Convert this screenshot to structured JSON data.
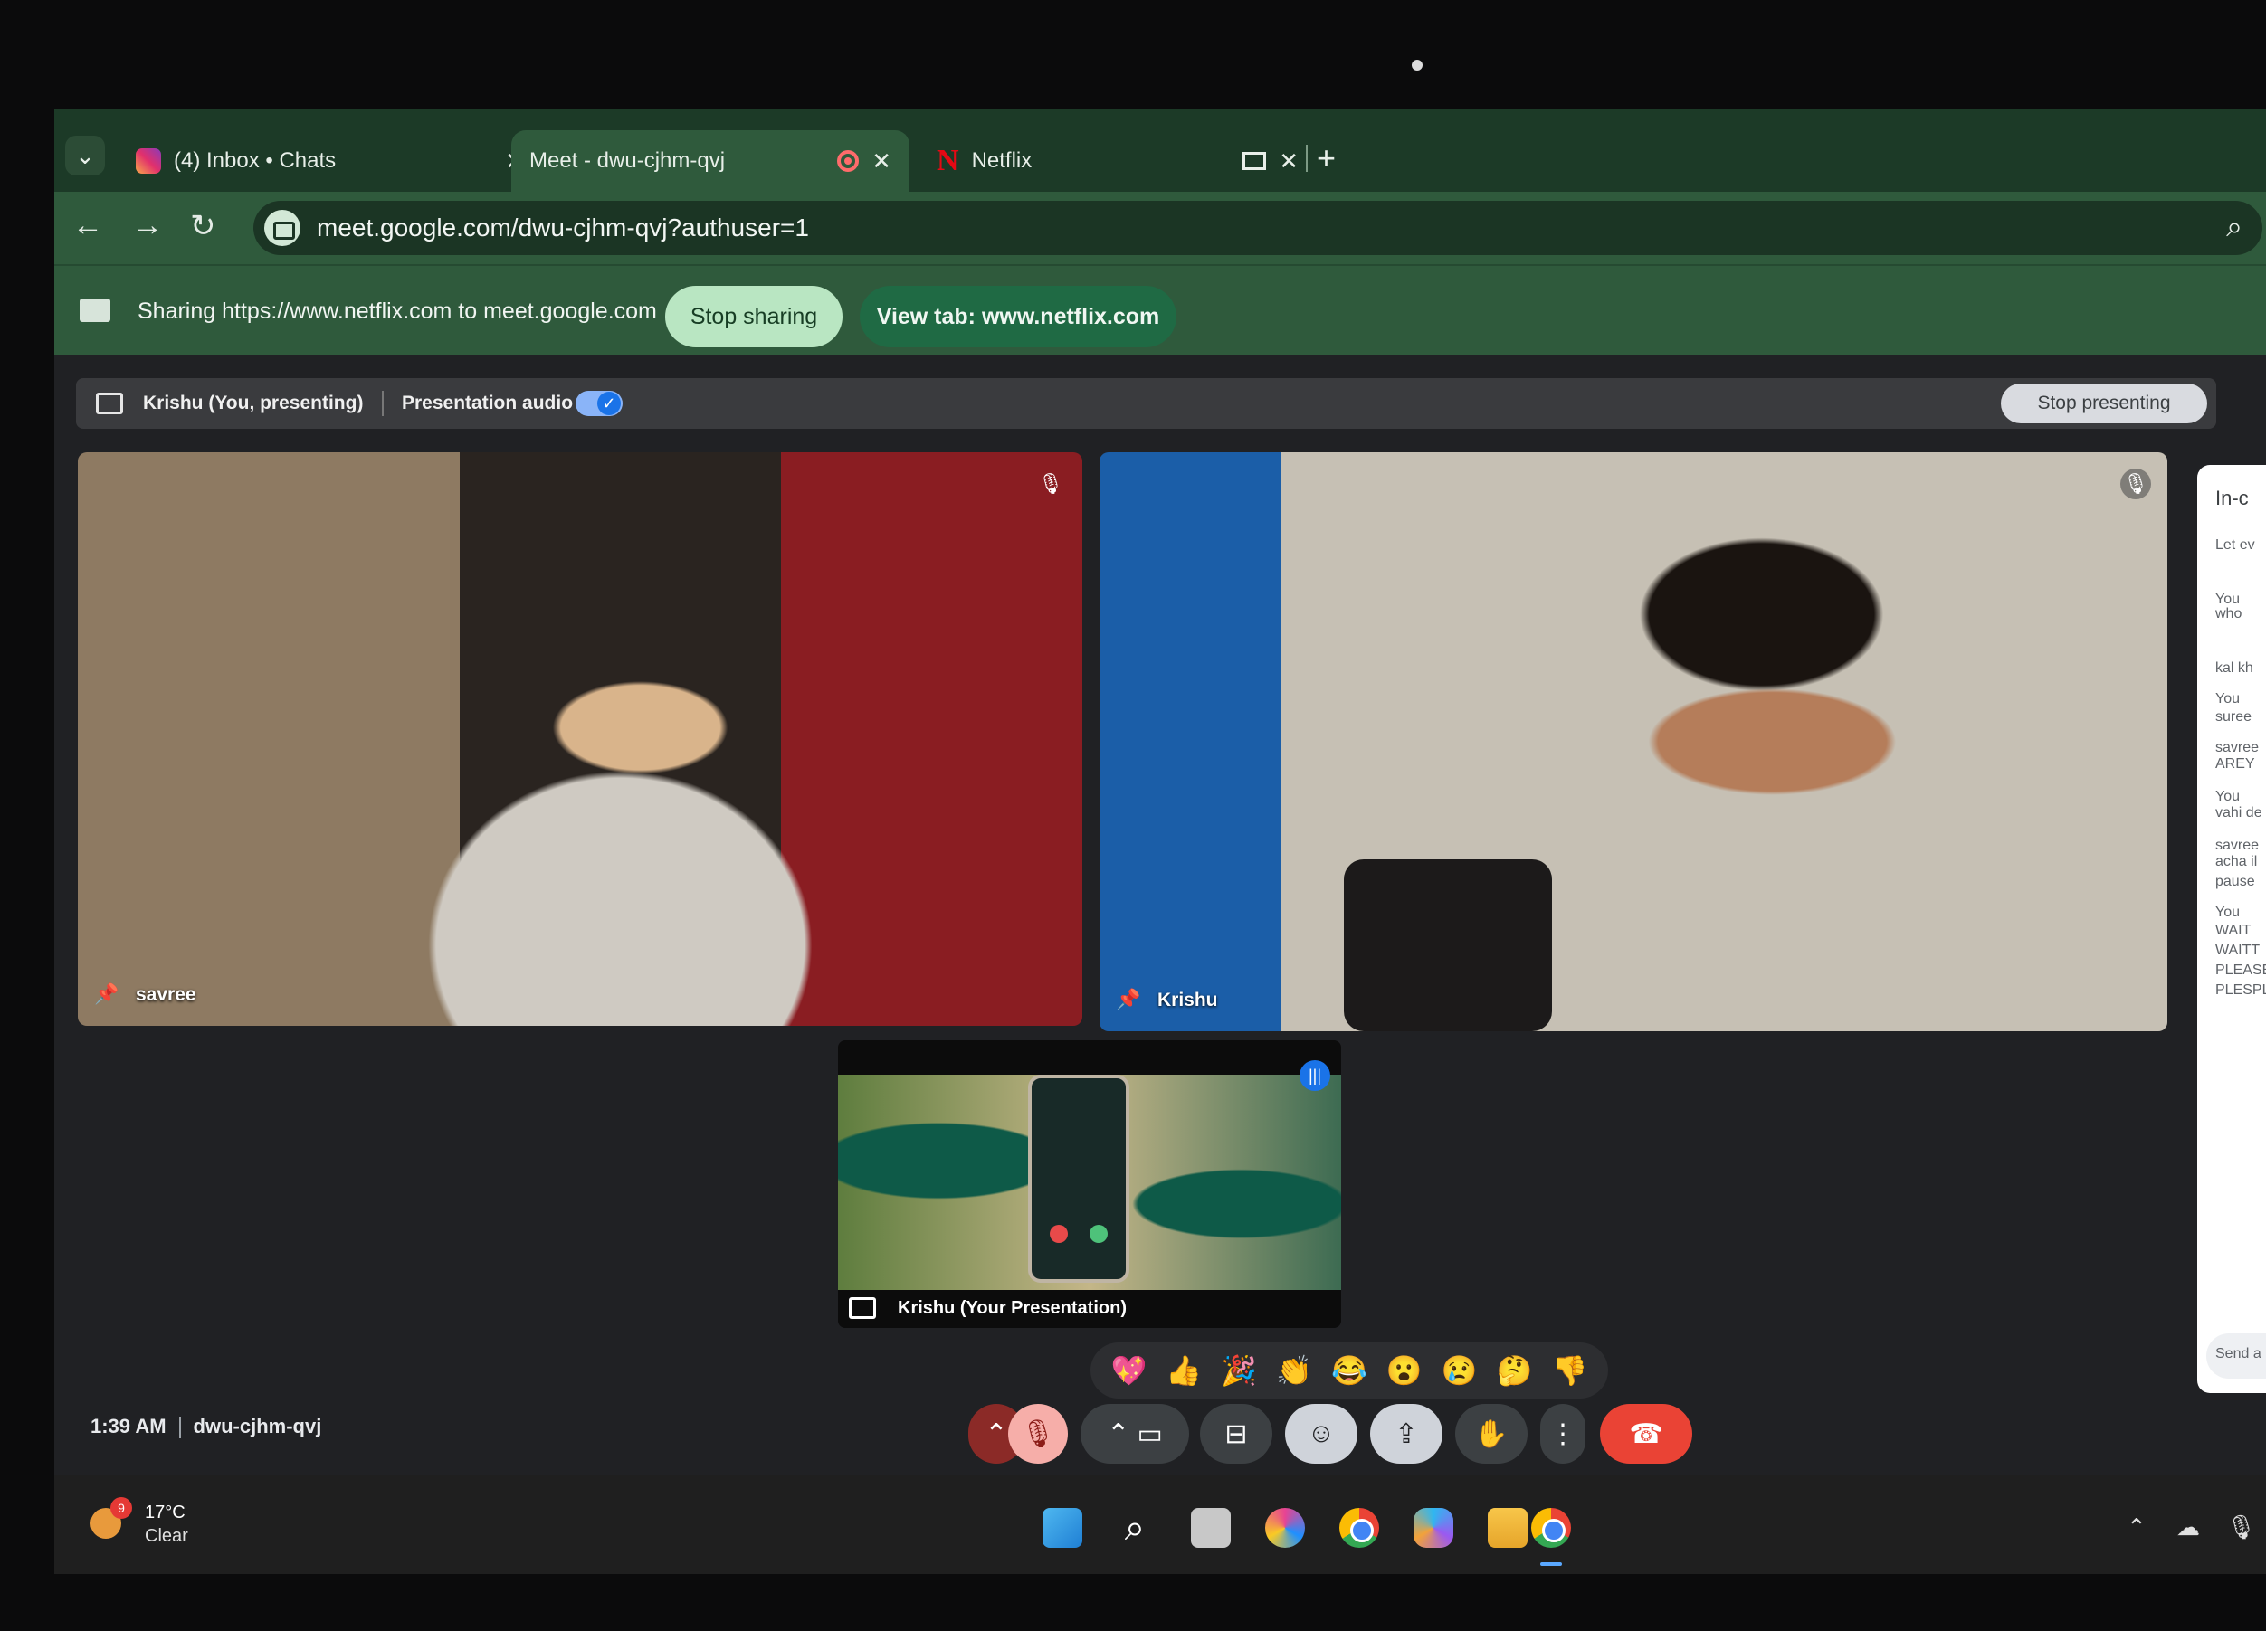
{
  "browser": {
    "tabs": [
      {
        "label": "(4) Inbox • Chats",
        "icon": "instagram-icon"
      },
      {
        "label": "Meet - dwu-cjhm-qvj",
        "icon": "google-meet-icon",
        "active": true
      },
      {
        "label": "Netflix",
        "icon": "netflix-icon"
      }
    ],
    "url": "meet.google.com/dwu-cjhm-qvj?authuser=1"
  },
  "infobar": {
    "sharing_text": "Sharing https://www.netflix.com to meet.google.com",
    "stop_sharing": "Stop sharing",
    "view_tab": "View tab: www.netflix.com"
  },
  "meet": {
    "presenting_label": "Krishu (You, presenting)",
    "presentation_audio": "Presentation audio",
    "presentation_audio_on": true,
    "stop_presenting": "Stop presenting",
    "participants": [
      {
        "name": "savree",
        "muted": true
      },
      {
        "name": "Krishu",
        "muted": true
      }
    ],
    "presentation_caption": "Krishu (Your Presentation)",
    "reactions": [
      "💖",
      "👍",
      "🎉",
      "👏",
      "😂",
      "😮",
      "😢",
      "🤔",
      "👎"
    ],
    "time": "1:39 AM",
    "meeting_code": "dwu-cjhm-qvj",
    "end_call_color": "#ea4335"
  },
  "chat": {
    "header": "In-c",
    "messages": [
      "Let ev",
      "You",
      "who",
      "kal kh",
      "You",
      "suree",
      "savree",
      "AREY",
      "You",
      "vahi de",
      "savree",
      "acha il",
      "pause",
      "You",
      "WAIT",
      "WAITT",
      "PLEASE",
      "PLESPL"
    ],
    "input_placeholder": "Send a"
  },
  "taskbar": {
    "weather_temp": "17°C",
    "weather_cond": "Clear",
    "weather_badge": "9"
  }
}
